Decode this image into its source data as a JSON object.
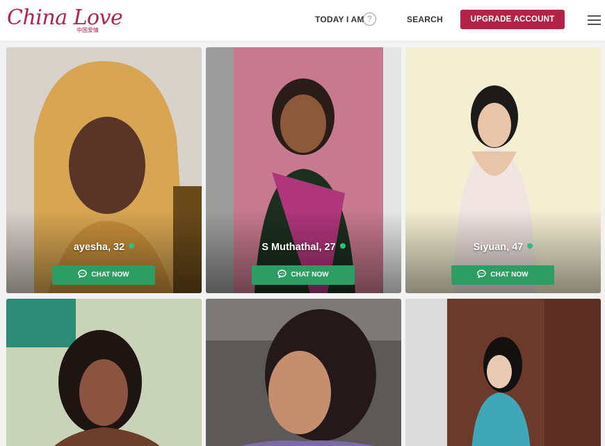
{
  "header": {
    "logo_text": "China Love",
    "logo_sub": "中国爱情",
    "today_label": "TODAY I AM",
    "help_icon": "?",
    "search_label": "SEARCH",
    "upgrade_label": "UPGRADE ACCOUNT",
    "icons": [
      "help-circle-icon",
      "hamburger-menu-icon"
    ],
    "brand_color": "#b42347"
  },
  "cards": [
    {
      "name": "ayesha, 32",
      "online": true,
      "chat_label": "CHAT NOW"
    },
    {
      "name": "S Muthathal, 27",
      "online": true,
      "chat_label": "CHAT NOW"
    },
    {
      "name": "Siyuan, 47",
      "online": true,
      "chat_label": "CHAT NOW"
    }
  ],
  "accent_color": "#2e9d64",
  "online_color": "#3cb878"
}
